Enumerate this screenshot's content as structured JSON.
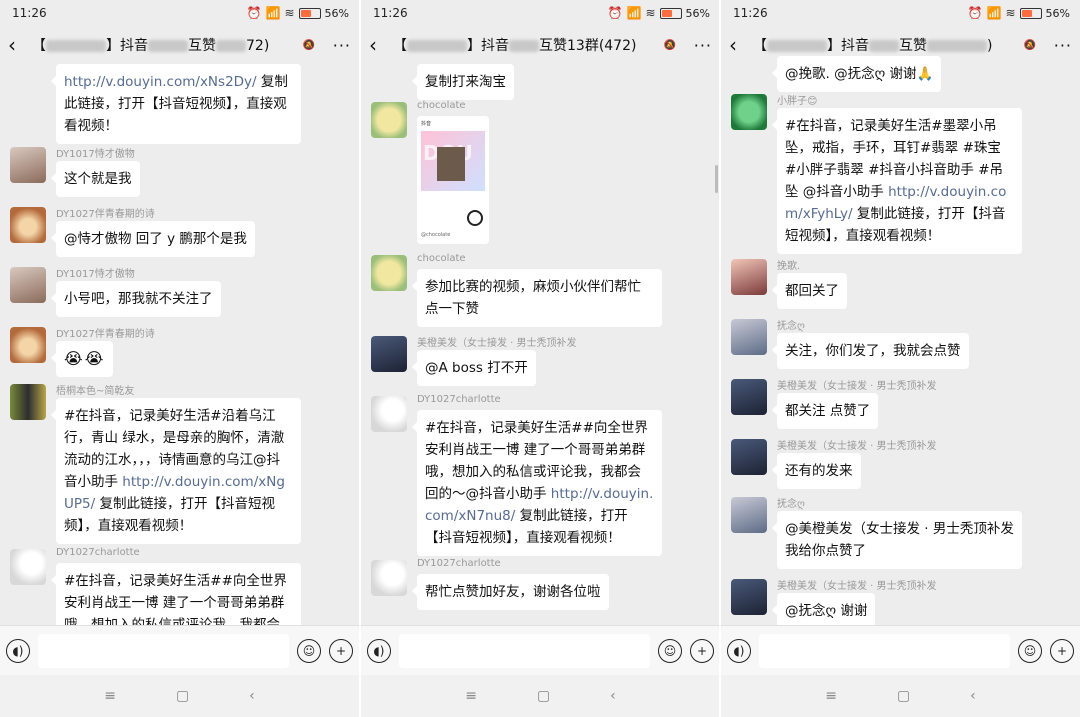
{
  "status": {
    "time": "11:26",
    "battery": "56%",
    "battery_level": 0.56
  },
  "colors": {
    "background": "#ededed",
    "bubble": "#ffffff",
    "link": "#576b95",
    "battery": "#ff6b3d"
  },
  "icons": {
    "back": "back-arrow-icon",
    "more": "more-icon",
    "voice": "voice-icon",
    "emoji": "emoji-icon",
    "plus": "plus-icon"
  },
  "panels": [
    {
      "title": {
        "pre": "【",
        "mid": "】抖音",
        "mid2": "互赞",
        "post": "72)"
      },
      "messages": [
        {
          "segments": [
            {
              "t": "http://v.douyin.com/xNs2Dy/",
              "link": true
            },
            {
              "t": " 复制此链接，打开【抖音短视频】，直接观看视频！"
            }
          ]
        },
        {
          "sender": "DY1017恃才傲物",
          "segments": [
            {
              "t": "这个就是我"
            }
          ]
        },
        {
          "sender": "DY1027伴青春期的诗",
          "segments": [
            {
              "t": "@恃才傲物  回了 y 鹏那个是我"
            }
          ]
        },
        {
          "sender": "DY1017恃才傲物",
          "segments": [
            {
              "t": "小号吧，那我就不关注了"
            }
          ]
        },
        {
          "sender": "DY1027伴青春期的诗",
          "segments": [
            {
              "t": "😭😭"
            }
          ]
        },
        {
          "sender": "梧桐本色~简乾友",
          "segments": [
            {
              "t": "#在抖音，记录美好生活#沿着乌江行，青山 绿水，是母亲的胸怀，清澈流动的江水，，，诗情画意的乌江@抖音小助手 "
            },
            {
              "t": "http://v.douyin.com/xNgUP5/",
              "link": true
            },
            {
              "t": " 复制此链接，打开【抖音短视频】，直接观看视频！"
            }
          ]
        },
        {
          "sender": "DY1027charlotte",
          "segments": [
            {
              "t": "#在抖音，记录美好生活##向全世界安利肖战王一博 建了一个哥哥弟弟群哦，想加入的私信或评论我，我都会"
            }
          ]
        }
      ]
    },
    {
      "title": {
        "pre": "【",
        "mid": "】抖音",
        "mid2": "互赞13群(472)",
        "post": ""
      },
      "messages": [
        {
          "segments": [
            {
              "t": "复制打来淘宝"
            }
          ]
        },
        {
          "sender": "chocolate",
          "card": {
            "head": "抖音",
            "art_text": "DOU",
            "foot": "@chocolate"
          }
        },
        {
          "sender": "chocolate",
          "segments": [
            {
              "t": "参加比赛的视频，麻烦小伙伴们帮忙点一下赞"
            }
          ]
        },
        {
          "sender": "美橙美发（女士接发 · 男士秃顶补发",
          "segments": [
            {
              "t": "@A   boss  打不开"
            }
          ]
        },
        {
          "sender": "DY1027charlotte",
          "segments": [
            {
              "t": "#在抖音，记录美好生活##向全世界安利肖战王一博 建了一个哥哥弟弟群哦，想加入的私信或评论我，我都会回的～@抖音小助手 "
            },
            {
              "t": "http://v.douyin.com/xN7nu8/",
              "link": true
            },
            {
              "t": " 复制此链接，打开【抖音短视频】，直接观看视频！"
            }
          ]
        },
        {
          "sender": "DY1027charlotte",
          "segments": [
            {
              "t": "帮忙点赞加好友，谢谢各位啦"
            }
          ]
        }
      ]
    },
    {
      "title": {
        "pre": "【",
        "mid": "】抖音",
        "mid2": "互赞",
        "post": ")"
      },
      "messages": [
        {
          "segments": [
            {
              "t": "@挽歌. @抚念ღ 谢谢🙏"
            }
          ]
        },
        {
          "sender": "小胖子😊",
          "segments": [
            {
              "t": "#在抖音，记录美好生活#墨翠小吊坠，戒指，手环，耳钉#翡翠 #珠宝 #小胖子翡翠 #抖音小抖音助手 #吊坠 @抖音小助手 "
            },
            {
              "t": "http://v.douyin.com/xFyhLy/",
              "link": true
            },
            {
              "t": " 复制此链接，打开【抖音短视频】，直接观看视频！"
            }
          ]
        },
        {
          "sender": "挽歌.",
          "segments": [
            {
              "t": "都回关了"
            }
          ]
        },
        {
          "sender": "抚念ღ",
          "segments": [
            {
              "t": "关注，你们发了，我就会点赞"
            }
          ]
        },
        {
          "sender": "美橙美发（女士接发 · 男士秃顶补发",
          "segments": [
            {
              "t": "都关注 点赞了"
            }
          ]
        },
        {
          "sender": "美橙美发（女士接发 · 男士秃顶补发",
          "segments": [
            {
              "t": "还有的发来"
            }
          ]
        },
        {
          "sender": "抚念ღ",
          "segments": [
            {
              "t": "@美橙美发（女士接发 · 男士秃顶补发  我给你点赞了"
            }
          ]
        },
        {
          "sender": "美橙美发（女士接发 · 男士秃顶补发",
          "segments": [
            {
              "t": "@抚念ღ 谢谢"
            }
          ]
        }
      ]
    }
  ]
}
